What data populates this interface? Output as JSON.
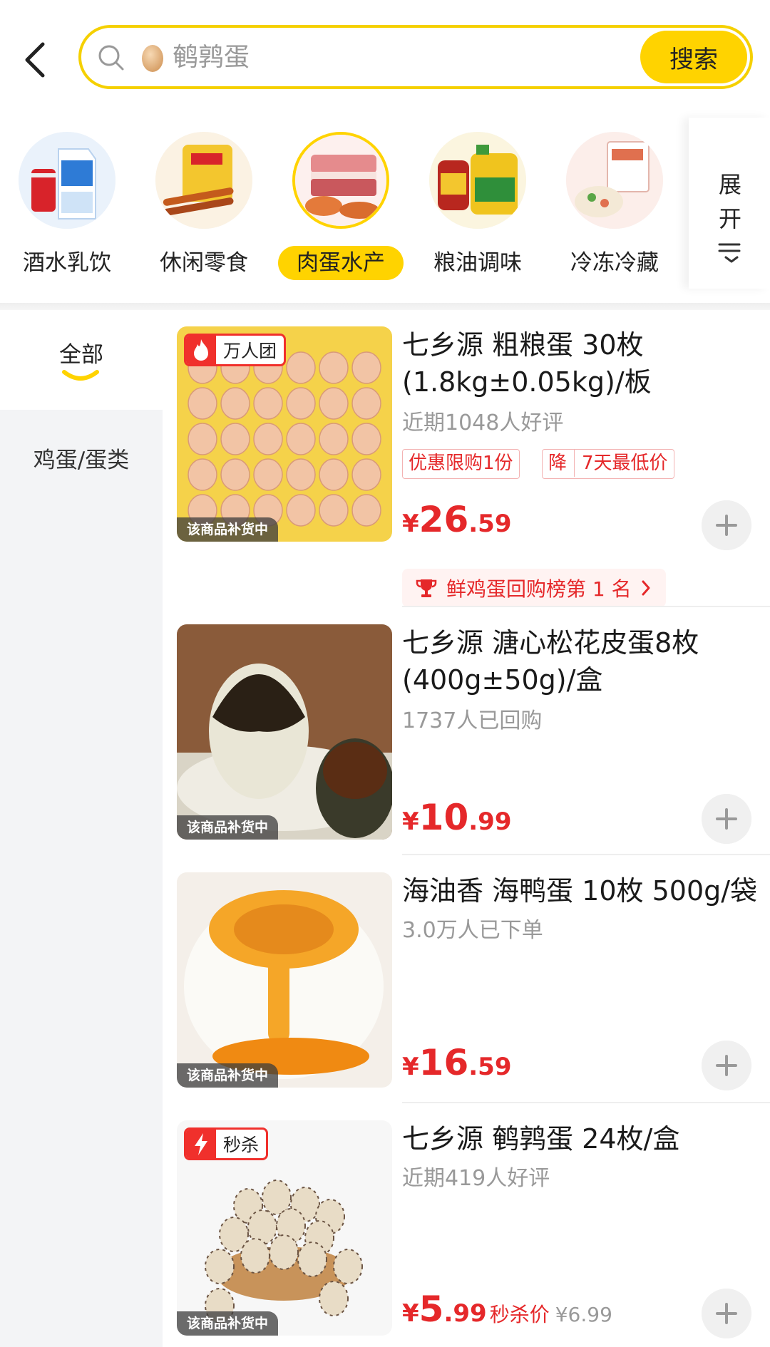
{
  "search": {
    "query": "鹌鹑蛋",
    "button_label": "搜索"
  },
  "categories": [
    {
      "label": "酒水乳饮",
      "active": false
    },
    {
      "label": "休闲零食",
      "active": false
    },
    {
      "label": "肉蛋水产",
      "active": true
    },
    {
      "label": "粮油调味",
      "active": false
    },
    {
      "label": "冷冻冷藏",
      "active": false
    }
  ],
  "category_expand": {
    "line1": "展",
    "line2": "开"
  },
  "side_nav": {
    "items": [
      {
        "label": "全部",
        "active": true
      },
      {
        "label": "鸡蛋/蛋类",
        "active": false
      }
    ]
  },
  "products": [
    {
      "title": "七乡源 粗粮蛋 30枚 (1.8kg±0.05kg)/板",
      "subtitle": "近期1048人好评",
      "tag": "万人团",
      "restock": "该商品补货中",
      "badges": [
        "优惠限购1份",
        "降",
        "7天最低价"
      ],
      "price_currency": "¥",
      "price_int": "26",
      "price_dec": ".59",
      "rank_text": "鲜鸡蛋回购榜第 1 名"
    },
    {
      "title": "七乡源 溏心松花皮蛋8枚 (400g±50g)/盒",
      "subtitle": "1737人已回购",
      "restock": "该商品补货中",
      "price_currency": "¥",
      "price_int": "10",
      "price_dec": ".99"
    },
    {
      "title": "海油香 海鸭蛋 10枚 500g/袋",
      "subtitle": "3.0万人已下单",
      "restock": "该商品补货中",
      "price_currency": "¥",
      "price_int": "16",
      "price_dec": ".59"
    },
    {
      "title": "七乡源 鹌鹑蛋 24枚/盒",
      "subtitle": "近期419人好评",
      "tag": "秒杀",
      "restock": "该商品补货中",
      "price_currency": "¥",
      "price_int": "5",
      "price_dec": ".99",
      "flash_label": "秒杀价",
      "original_price": "¥6.99"
    }
  ],
  "colors": {
    "accent_yellow": "#ffd300",
    "price_red": "#e5282a",
    "tag_red": "#f0302c"
  }
}
